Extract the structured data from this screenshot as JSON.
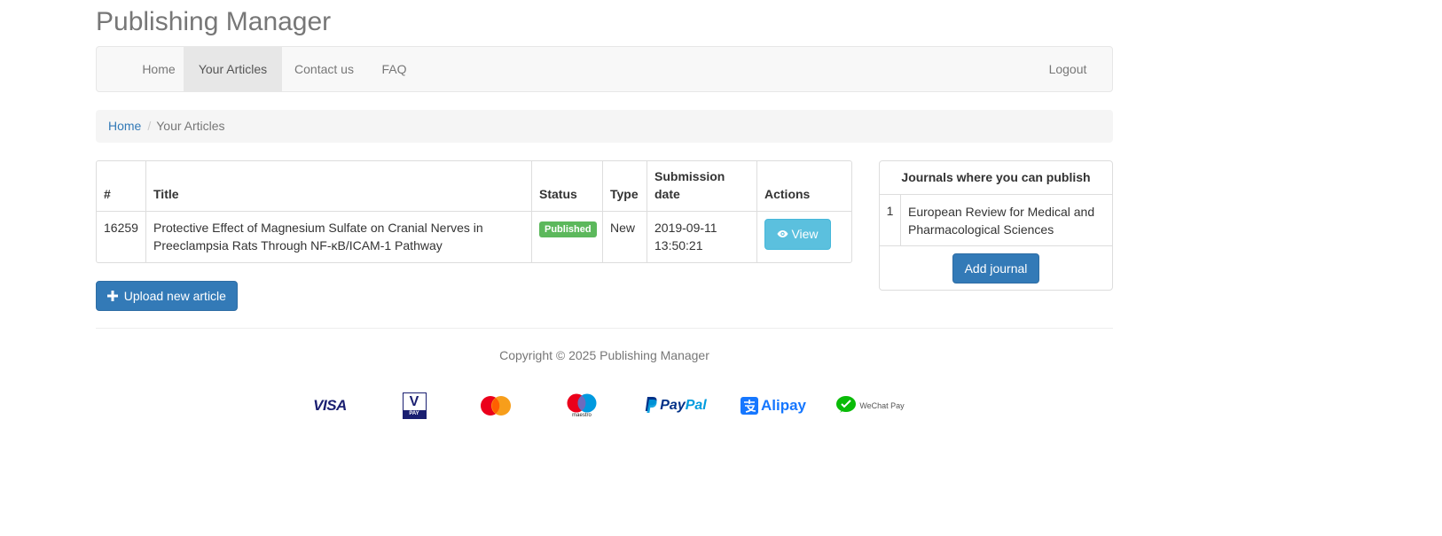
{
  "app": {
    "title": "Publishing Manager"
  },
  "nav": {
    "items": [
      {
        "label": "Home",
        "active": false
      },
      {
        "label": "Your Articles",
        "active": true
      },
      {
        "label": "Contact us",
        "active": false
      },
      {
        "label": "FAQ",
        "active": false
      }
    ],
    "logout_label": "Logout"
  },
  "breadcrumb": {
    "home": "Home",
    "separator": "/",
    "current": "Your Articles"
  },
  "articles": {
    "columns": [
      "#",
      "Title",
      "Status",
      "Type",
      "Submission date",
      "Actions"
    ],
    "rows": [
      {
        "id": "16259",
        "title": "Protective Effect of Magnesium Sulfate on Cranial Nerves in Preeclampsia Rats Through NF-κB/ICAM-1 Pathway",
        "status": "Published",
        "type": "New",
        "date": "2019-09-11 13:50:21",
        "action_label": "View"
      }
    ]
  },
  "upload": {
    "label": "Upload new article"
  },
  "journals": {
    "heading": "Journals where you can publish",
    "items": [
      {
        "index": "1",
        "name": "European Review for Medical and Pharmacological Sciences"
      }
    ],
    "add_label": "Add journal"
  },
  "footer": {
    "copyright": "Copyright © 2025 Publishing Manager"
  },
  "payments": {
    "visa": "VISA",
    "vpay_top": "V",
    "vpay_bottom": "PAY",
    "maestro": "maestro",
    "paypal_pay": "Pay",
    "paypal_pal": "Pal",
    "alipay": "Alipay",
    "wechat": "WeChat Pay"
  },
  "colors": {
    "primary": "#337ab7",
    "info": "#5bc0de",
    "success": "#5cb85c",
    "link": "#337ab7"
  }
}
